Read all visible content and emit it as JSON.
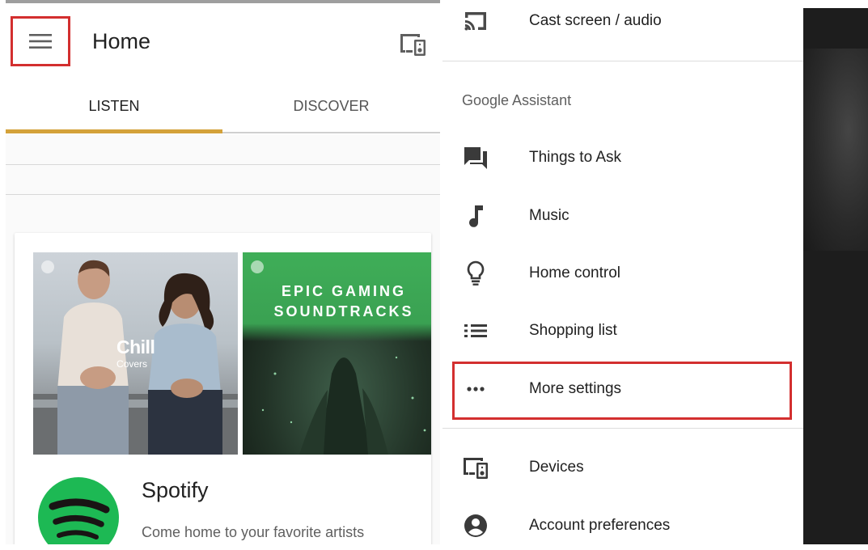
{
  "app_bar": {
    "title": "Home"
  },
  "tabs": [
    {
      "label": "LISTEN",
      "selected": true
    },
    {
      "label": "DISCOVER",
      "selected": false
    }
  ],
  "card": {
    "playlists": [
      {
        "title": "Chill",
        "subtitle": "Covers"
      },
      {
        "title": "EPIC GAMING\nSOUNDTRACKS",
        "subtitle": ""
      }
    ],
    "service_name": "Spotify",
    "service_description": "Come home to your favorite artists"
  },
  "drawer": {
    "cast_item": {
      "label": "Cast screen / audio",
      "icon": "cast-icon"
    },
    "section_header": "Google Assistant",
    "assistant_items": [
      {
        "label": "Things to Ask",
        "icon": "chat-icon"
      },
      {
        "label": "Music",
        "icon": "music-note-icon"
      },
      {
        "label": "Home control",
        "icon": "lightbulb-icon"
      },
      {
        "label": "Shopping list",
        "icon": "list-icon"
      },
      {
        "label": "More settings",
        "icon": "more-horiz-icon"
      }
    ],
    "bottom_items": [
      {
        "label": "Devices",
        "icon": "devices-icon"
      },
      {
        "label": "Account preferences",
        "icon": "account-circle-icon"
      }
    ]
  },
  "colors": {
    "tab_indicator": "#d4a23a",
    "highlight_box": "#d32f2f",
    "spotify_green": "#1db954",
    "gaming_green": "#3fae58"
  }
}
